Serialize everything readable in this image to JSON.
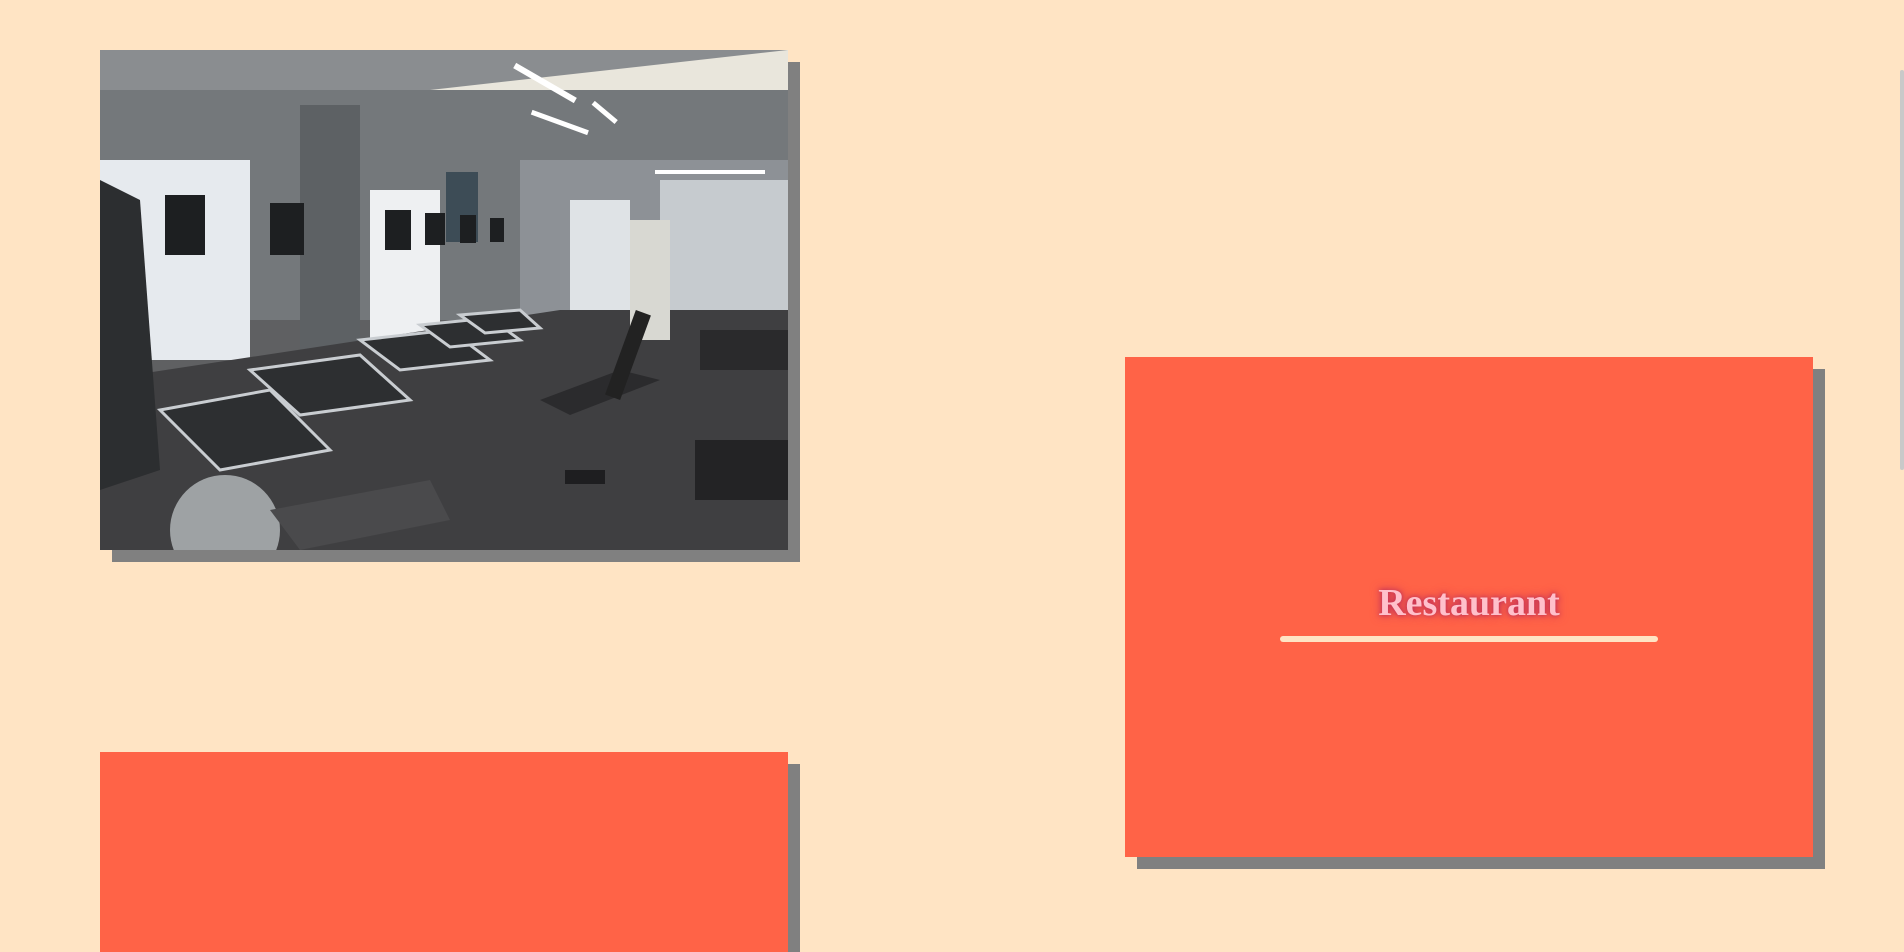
{
  "cards": {
    "gym": {
      "image_description": "gym-photo"
    },
    "restaurant": {
      "title": "Restaurant"
    }
  },
  "colors": {
    "page_background": "#FFE4C4",
    "card_accent": "#FF6347",
    "card_shadow": "#808080",
    "title_text": "#FFC0CB"
  }
}
